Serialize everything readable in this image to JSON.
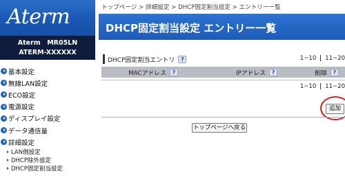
{
  "brand": {
    "logo": "Aterm",
    "model_line1": "Aterm　MR05LN",
    "model_line2": "ATERM-XXXXXX"
  },
  "nav": {
    "items": [
      "基本設定",
      "無線LAN設定",
      "ECO設定",
      "電源設定",
      "ディスプレイ設定",
      "データ通信量",
      "詳細設定"
    ],
    "sub_items": [
      "LAN側設定",
      "DHCP除外設定",
      "DHCP固定割当設定"
    ]
  },
  "breadcrumb": "トップページ > 詳細設定 > DHCP固定割当設定 > エントリー一覧",
  "page_title": "DHCP固定割当設定 エントリー一覧",
  "section": {
    "title": "DHCP固定割当エントリ",
    "help": "?"
  },
  "pager": {
    "range1": "1~10",
    "range2": "11~20"
  },
  "table": {
    "col_mac": "MACアドレス",
    "col_ip": "IPアドレス",
    "col_delete": "削除",
    "help": "?"
  },
  "buttons": {
    "add": "追加",
    "back": "トップページへ戻る"
  },
  "colors": {
    "accent_blue": "#1c5cb8",
    "dark_navy": "#0e1d3d",
    "highlight_red": "#e01a1a"
  }
}
